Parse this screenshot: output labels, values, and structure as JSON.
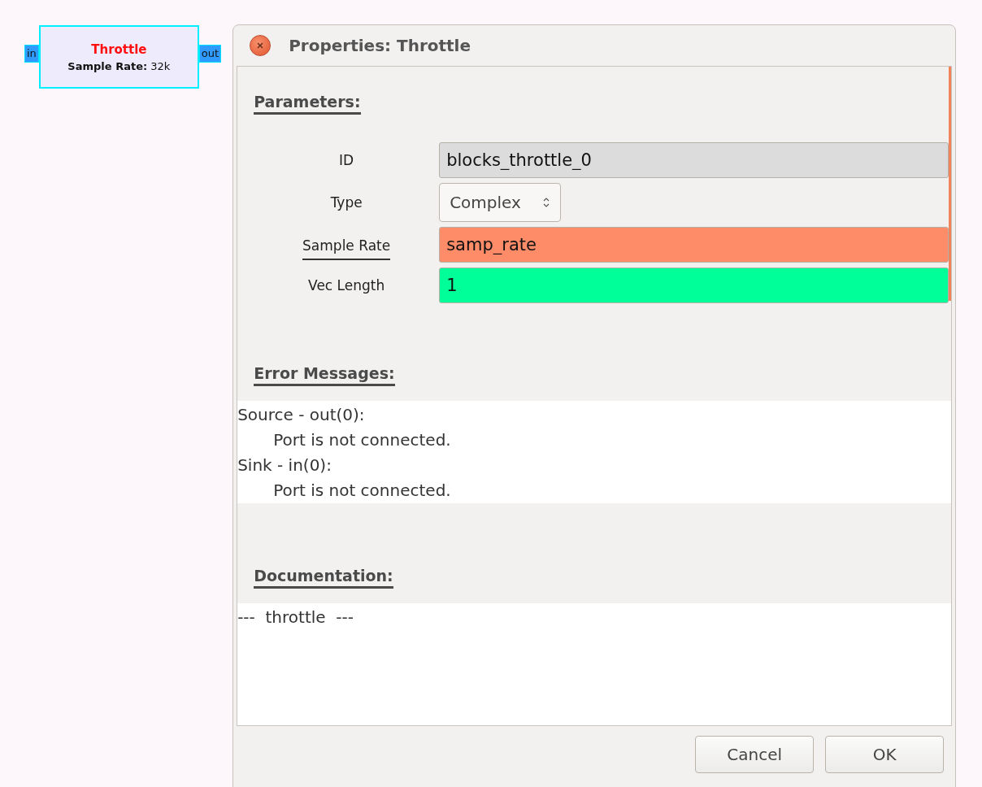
{
  "block": {
    "title": "Throttle",
    "params": [
      "**Sample Rate:** 32k"
    ],
    "ports": [
      {
        "kind": "in",
        "label": "in"
      },
      {
        "kind": "out",
        "label": "out"
      }
    ]
  },
  "dialog": {
    "title": "Properties: Throttle",
    "sections": [
      {
        "kind": "params",
        "heading": "Parameters:",
        "params": [
          {
            "kind": "entry",
            "label": "ID",
            "value": "blocks_throttle_0",
            "color": "#dcdcdc",
            "underlined": false
          },
          {
            "kind": "combo",
            "label": "Type",
            "value": "Complex",
            "underlined": false
          },
          {
            "kind": "entry",
            "label": "Sample Rate",
            "value": "samp_rate",
            "color": "#ff8c69",
            "underlined": true
          },
          {
            "kind": "entry",
            "label": "Vec Length",
            "value": "1",
            "color": "#00ff99",
            "underlined": false
          }
        ]
      },
      {
        "kind": "errors",
        "heading": "Error Messages:",
        "errors": [
          {
            "source": "Source - out(0):",
            "message": "Port is not connected."
          },
          {
            "source": "Sink - in(0):",
            "message": "Port is not connected."
          }
        ]
      },
      {
        "kind": "doc",
        "heading": "Documentation:",
        "text": "---  throttle  ---"
      }
    ],
    "buttons": [
      "Cancel",
      "OK"
    ]
  }
}
